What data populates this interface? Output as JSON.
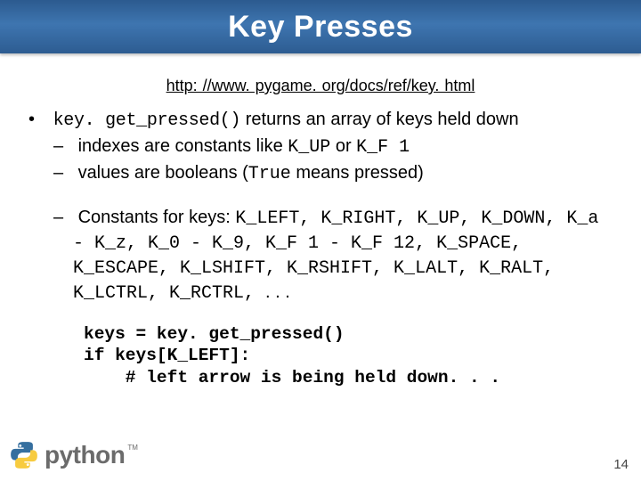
{
  "title": "Key Presses",
  "docUrl": "http: //www. pygame. org/docs/ref/key. html",
  "bullet1": {
    "code": "key. get_pressed()",
    "rest": " returns an array of keys held down"
  },
  "sub1a": {
    "pre": "indexes are constants like ",
    "c1": "K_UP",
    "mid": " or ",
    "c2": "K_F 1"
  },
  "sub1b": {
    "pre": "values are booleans (",
    "c1": "True",
    "post": " means pressed)"
  },
  "sub2": {
    "pre": "Constants for keys: ",
    "codes": "K_LEFT, K_RIGHT, K_UP, K_DOWN, K_a - K_z, K_0 - K_9, K_F 1 - K_F 12, K_SPACE, K_ESCAPE, K_LSHIFT, K_RSHIFT, K_LALT, K_RALT, K_LCTRL, K_RCTRL, ",
    "ellipsis": ". . ."
  },
  "code": "keys = key. get_pressed()\nif keys[K_LEFT]:\n    # left arrow is being held down. . .",
  "pageNum": "14",
  "logoText": "python",
  "tm": "TM"
}
